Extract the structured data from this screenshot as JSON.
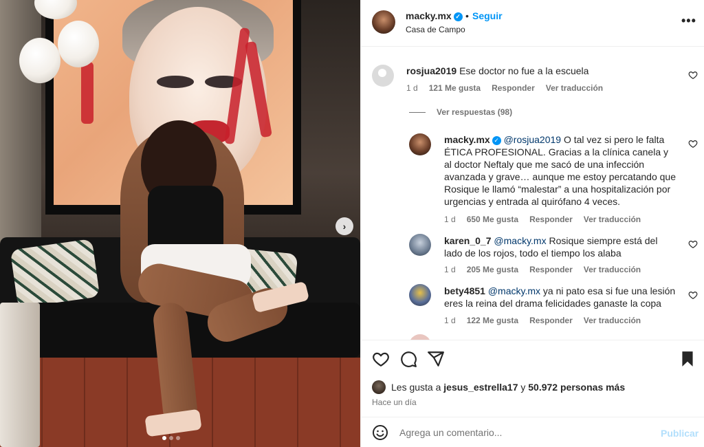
{
  "header": {
    "username": "macky.mx",
    "separator": "•",
    "follow_label": "Seguir",
    "location": "Casa de Campo",
    "more_label": "•••"
  },
  "comments": [
    {
      "username": "rosjua2019",
      "text": "Ese doctor no fue a la escuela",
      "time": "1 d",
      "likes": "121 Me gusta",
      "reply_label": "Responder",
      "translate_label": "Ver traducción"
    }
  ],
  "view_replies_label": "Ver respuestas (98)",
  "replies": [
    {
      "username": "macky.mx",
      "mention": "@rosjua2019",
      "text": "O tal vez si pero le falta ÉTICA PROFESIONAL. Gracias a la clínica canela y al doctor Neftaly que me sacó de una infección avanzada y grave… aunque me estoy percatando que Rosique le llamó “malestar” a una hospitalización por urgencias y entrada al quirófano 4 veces.",
      "time": "1 d",
      "likes": "650 Me gusta",
      "reply_label": "Responder",
      "translate_label": "Ver traducción"
    },
    {
      "username": "karen_0_7",
      "mention": "@macky.mx",
      "text": "Rosique siempre está del lado de los rojos, todo el tiempo los alaba",
      "time": "1 d",
      "likes": "205 Me gusta",
      "reply_label": "Responder",
      "translate_label": "Ver traducción"
    },
    {
      "username": "bety4851",
      "mention": "@macky.mx",
      "text": "ya ni pato esa si fue una lesión eres la reina del drama felicidades ganaste la copa",
      "time": "1 d",
      "likes": "122 Me gusta",
      "reply_label": "Responder",
      "translate_label": "Ver traducción"
    }
  ],
  "likes": {
    "prefix": "Les gusta a",
    "user": "jesus_estrella17",
    "connector": "y",
    "others": "50.972 personas más"
  },
  "post_time": "Hace un día",
  "add_comment": {
    "placeholder": "Agrega un comentario...",
    "post_label": "Publicar"
  },
  "colors": {
    "accent": "#0095f6",
    "mention": "#00376b",
    "muted": "#737373"
  },
  "icons": [
    "more-icon",
    "verified-icon",
    "heart-icon",
    "comment-icon",
    "share-icon",
    "bookmark-icon",
    "emoji-icon",
    "chevron-right-icon"
  ]
}
